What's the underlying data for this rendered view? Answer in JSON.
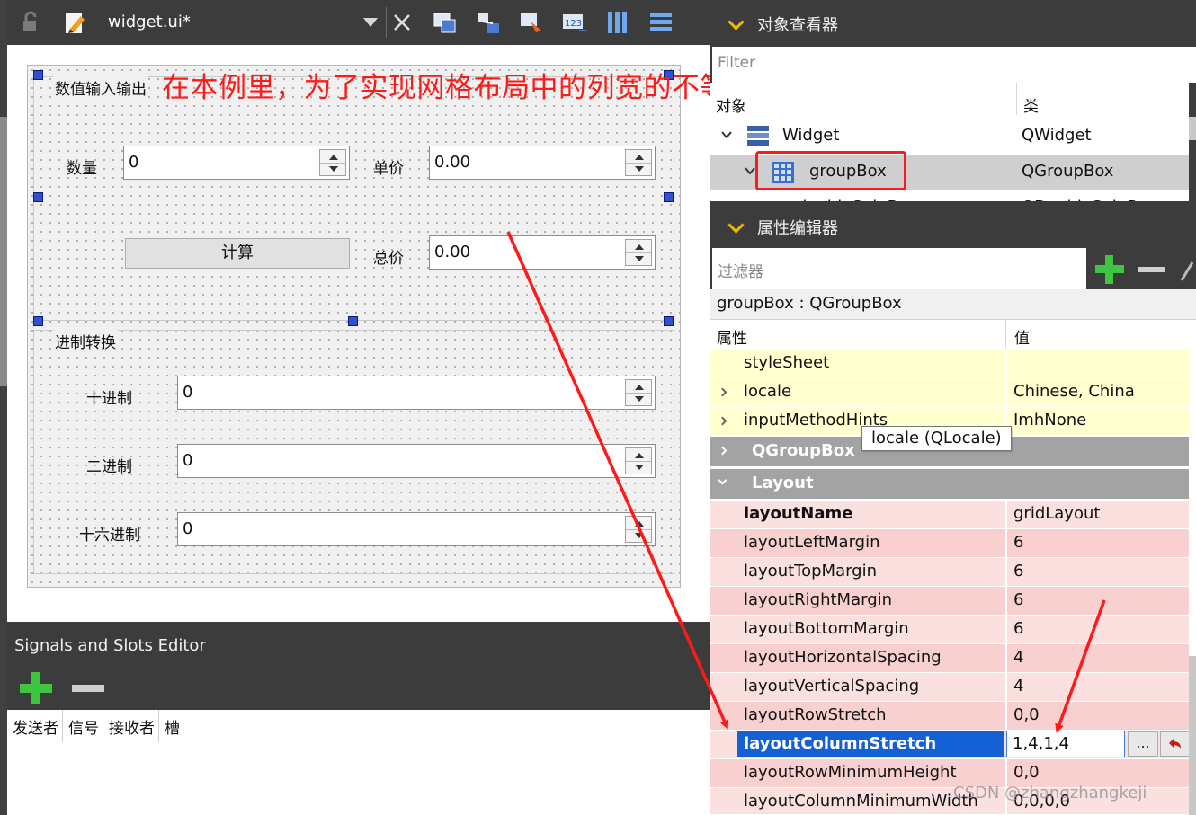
{
  "toolbar": {
    "file_name": "widget.ui*",
    "icons": [
      "lock-icon",
      "edit-icon",
      "dropdown-icon",
      "close-icon",
      "edit-widgets-icon",
      "edit-signals-slots-icon",
      "edit-buddies-icon",
      "edit-tab-order-icon",
      "layout-horizontal-icon",
      "layout-vertical-icon"
    ]
  },
  "annotation": "在本例里，为了实现网格布局中的列宽的不等，  使用了列方向上的伸缩因子",
  "form": {
    "group1_title": "数值输入输出",
    "qty_label": "数量",
    "qty_value": "0",
    "price_label": "单价",
    "price_value": "0.00",
    "calc_button": "计算",
    "total_label": "总价",
    "total_value": "0.00",
    "group2_title": "进制转换",
    "dec_label": "十进制",
    "dec_value": "0",
    "bin_label": "二进制",
    "bin_value": "0",
    "hex_label": "十六进制",
    "hex_value": "0"
  },
  "signals": {
    "title": "Signals and Slots Editor",
    "columns": [
      "发送者",
      "信号",
      "接收者",
      "槽"
    ]
  },
  "object_inspector": {
    "title": "对象查看器",
    "filter_placeholder": "Filter",
    "col_object": "对象",
    "col_class": "类",
    "rows": [
      {
        "name": "Widget",
        "class": "QWidget"
      },
      {
        "name": "groupBox",
        "class": "QGroupBox"
      },
      {
        "name": "doubleSpinBox",
        "class": "QDoubleSpinBox"
      }
    ]
  },
  "property_editor": {
    "title": "属性编辑器",
    "filter_placeholder": "过滤器",
    "object_label": "groupBox : QGroupBox",
    "col_property": "属性",
    "col_value": "值",
    "tooltip": "locale (QLocale)",
    "rows": [
      {
        "name": "styleSheet",
        "value": ""
      },
      {
        "name": "locale",
        "value": "Chinese, China"
      },
      {
        "name": "inputMethodHints",
        "value": "ImhNone"
      },
      {
        "name": "QGroupBox",
        "value": ""
      },
      {
        "name": "Layout",
        "value": ""
      },
      {
        "name": "layoutName",
        "value": "gridLayout"
      },
      {
        "name": "layoutLeftMargin",
        "value": "6"
      },
      {
        "name": "layoutTopMargin",
        "value": "6"
      },
      {
        "name": "layoutRightMargin",
        "value": "6"
      },
      {
        "name": "layoutBottomMargin",
        "value": "6"
      },
      {
        "name": "layoutHorizontalSpacing",
        "value": "4"
      },
      {
        "name": "layoutVerticalSpacing",
        "value": "4"
      },
      {
        "name": "layoutRowStretch",
        "value": "0,0"
      },
      {
        "name": "layoutColumnStretch",
        "value": "1,4,1,4"
      },
      {
        "name": "layoutRowMinimumHeight",
        "value": "0,0"
      },
      {
        "name": "layoutColumnMinimumWidth",
        "value": "0,0,0,0"
      }
    ],
    "edit_more": "...",
    "reset_icon": "reset-arrow-icon"
  },
  "watermark": "CSDN @zhangzhangkeji",
  "colors": {
    "annotation": "#ff1a1a",
    "accent_chevron": "#f0b800",
    "selection": "#1560d4"
  }
}
